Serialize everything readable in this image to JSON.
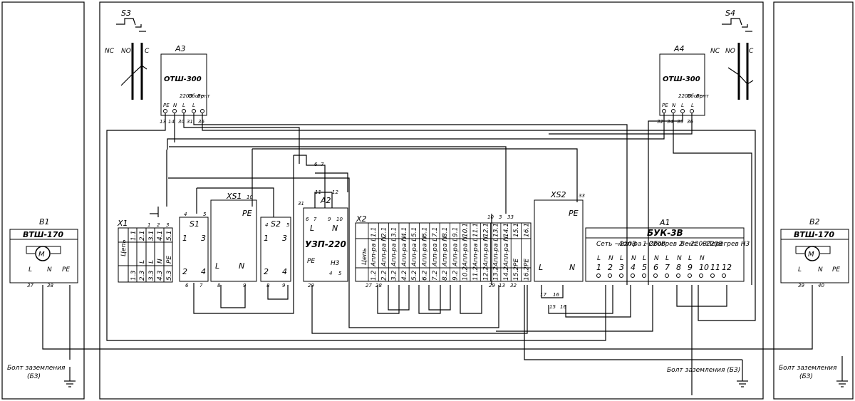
{
  "panels": {
    "left_box": {
      "ref": "B1",
      "title": "ВТШ-170",
      "terminals": [
        "L",
        "N",
        "PE"
      ],
      "nums": [
        "37",
        "38"
      ],
      "ground": "Болт заземления",
      "ground_short": "(БЗ)"
    },
    "right_box": {
      "ref": "B2",
      "title": "ВТШ-170",
      "terminals": [
        "L",
        "N",
        "PE"
      ],
      "nums": [
        "39",
        "40"
      ],
      "ground": "Болт заземления",
      "ground_short": "(БЗ)"
    }
  },
  "switches": {
    "s3": {
      "ref": "S3",
      "contacts": [
        "NC",
        "NO",
        "C"
      ]
    },
    "s4": {
      "ref": "S4",
      "contacts": [
        "NC",
        "NO",
        "C"
      ]
    }
  },
  "thermostats": {
    "a3": {
      "ref": "A3",
      "title": "ОТШ-300",
      "top": [
        "220В",
        "Обогр",
        "Вент"
      ],
      "terms": [
        "PE",
        "N",
        "L",
        "L"
      ],
      "nums": [
        "13",
        "14",
        "30",
        "31",
        "36"
      ]
    },
    "a4": {
      "ref": "A4",
      "title": "ОТШ-300",
      "top": [
        "220В",
        "Обогр",
        "Вент"
      ],
      "terms": [
        "PE",
        "N",
        "L",
        "L"
      ],
      "nums": [
        "32",
        "34",
        "35",
        "36"
      ]
    }
  },
  "x1": {
    "ref": "X1",
    "top_nums": [
      "1",
      "2",
      "3"
    ],
    "header": "Цепь",
    "top_row": [
      "1.1",
      "2.1",
      "3.1",
      "4.1",
      "5.1"
    ],
    "bottom_row": [
      "1.3",
      "2.3",
      "3.3",
      "4.3",
      "5.3"
    ],
    "mid_row": [
      "1.2",
      "2.2",
      "3.2",
      "4.2",
      "5.2"
    ],
    "labels": [
      "L",
      "N",
      "PE"
    ],
    "labels2": [
      "L",
      "L",
      "N"
    ]
  },
  "s1": {
    "ref": "S1",
    "top": [
      "1",
      "3"
    ],
    "bottom": [
      "2",
      "4"
    ],
    "nums": [
      "4",
      "5",
      "6",
      "7"
    ]
  },
  "xs1": {
    "ref": "XS1",
    "pe": "PE",
    "num": "10",
    "l": "L",
    "n": "N",
    "bottom": [
      "8",
      "9"
    ]
  },
  "s2": {
    "ref": "S2",
    "top": [
      "1",
      "3"
    ],
    "bottom": [
      "2",
      "4"
    ],
    "nums": [
      "4",
      "5",
      "8",
      "9"
    ]
  },
  "a2": {
    "ref": "A2",
    "title": "УЗП-220",
    "pe": "PE",
    "h3": "Н3",
    "l": "L",
    "n": "N",
    "top_nums": [
      "31",
      "11",
      "12"
    ],
    "sub_nums": [
      "6",
      "7",
      "9",
      "10"
    ],
    "bottom": [
      "29",
      "4",
      "5"
    ],
    "extra": [
      "6",
      "7"
    ]
  },
  "x2": {
    "ref": "X2",
    "header": "Цепь",
    "cols": [
      "Апп-ра L",
      "Апп-ра N",
      "Апп-ра L",
      "Апп-ра N",
      "Апп-ра L",
      "Апп-ра N",
      "Апп-ра L",
      "Апп-ра N",
      "Апп-ра L",
      "Апп-ра N",
      "Апп-ра L",
      "Апп-ра N",
      "Апп-ра L",
      "Апп-ра N"
    ],
    "top_ids": [
      "1.1",
      "2.1",
      "3.1",
      "4.1",
      "5.1",
      "6.1",
      "7.1",
      "8.1",
      "9.1",
      "10.1",
      "11.1",
      "12.1",
      "13.1",
      "14.1",
      "15.1",
      "16.1"
    ],
    "bot_ids": [
      "1.2",
      "2.2",
      "3.2",
      "4.2",
      "5.2",
      "6.2",
      "7.2",
      "8.2",
      "9.2",
      "10.2",
      "11.2",
      "12.2",
      "13.2",
      "14.2",
      "15.2",
      "16.2"
    ],
    "pe_cols": [
      "PE",
      "PE",
      "PE",
      "PE"
    ],
    "top_nums": [
      "10",
      "3",
      "33"
    ],
    "bottom_nums": [
      "27",
      "28",
      "29",
      "13",
      "32"
    ],
    "pairs_top": [
      "27",
      "28",
      "25",
      "26",
      "23",
      "24",
      "21",
      "22",
      "19",
      "20",
      "17",
      "18"
    ],
    "pairs_bot": [
      "28",
      "26",
      "24",
      "22",
      "20",
      "18"
    ]
  },
  "xs2": {
    "ref": "XS2",
    "pe": "PE",
    "num": "33",
    "l": "L",
    "n": "N",
    "bottom": [
      "17",
      "16",
      "15",
      "16"
    ]
  },
  "a1": {
    "ref": "A1",
    "title": "БУК-3В",
    "groups": [
      "Сеть ~220В",
      "Апп-ра ~220В",
      "1 Обогрев 2 ~220В",
      "Вент. ~220В",
      "Перегрев Н3"
    ],
    "ln": [
      "L",
      "N",
      "L",
      "N",
      "L",
      "N",
      "L",
      "N",
      "L",
      "N"
    ],
    "terms": [
      "1",
      "2",
      "3",
      "4",
      "5",
      "6",
      "7",
      "8",
      "9",
      "10",
      "11",
      "12"
    ],
    "bottom": [
      "11",
      "12",
      "15",
      "16",
      "30",
      "14",
      "35",
      "34",
      "37",
      "39",
      "38",
      "40"
    ]
  },
  "ground_center": {
    "text": "Болт заземления (БЗ)"
  }
}
